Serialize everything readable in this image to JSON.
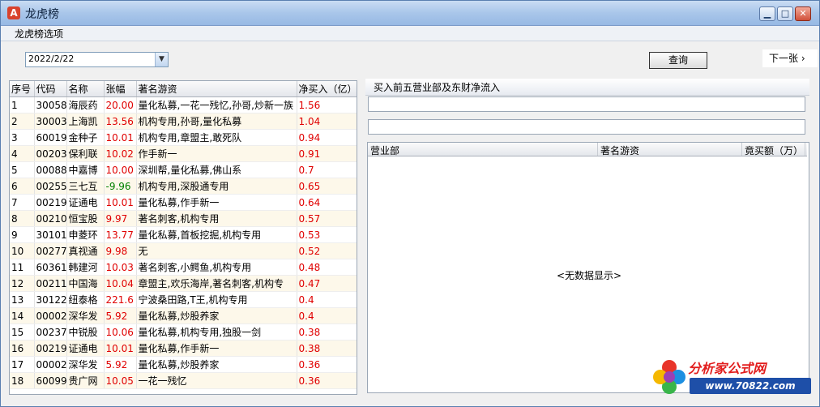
{
  "window": {
    "icon_label": "A",
    "title": "龙虎榜",
    "minimize_label": "▁",
    "maximize_label": "□",
    "close_label": "✕"
  },
  "menu": {
    "items": [
      "龙虎榜选项"
    ]
  },
  "toolbar": {
    "date_value": "2022/2/22",
    "dropdown_icon": "chevron-down-icon",
    "query_label": "查询",
    "next_page_label": "下一张 ›"
  },
  "left_table": {
    "columns": [
      "序号",
      "代码",
      "名称",
      "张幅",
      "著名游资",
      "净买入（亿）"
    ],
    "rows": [
      [
        "1",
        "30058",
        "海辰药",
        "20.00",
        "量化私募,一花一残忆,孙哥,炒新一族",
        "1.56"
      ],
      [
        "2",
        "30003",
        "上海凯",
        "13.56",
        "机构专用,孙哥,量化私募",
        "1.04"
      ],
      [
        "3",
        "60019",
        "金种子",
        "10.01",
        "机构专用,章盟主,敢死队",
        "0.94"
      ],
      [
        "4",
        "00203",
        "保利联",
        "10.02",
        "作手新一",
        "0.91"
      ],
      [
        "5",
        "00088",
        "中嘉博",
        "10.00",
        "深圳帮,量化私募,佛山系",
        "0.7"
      ],
      [
        "6",
        "00255",
        "三七互",
        "-9.96",
        "机构专用,深股通专用",
        "0.65"
      ],
      [
        "7",
        "00219",
        "证通电",
        "10.01",
        "量化私募,作手新一",
        "0.64"
      ],
      [
        "8",
        "00210",
        "恒宝股",
        "9.97",
        "著名刺客,机构专用",
        "0.57"
      ],
      [
        "9",
        "30101",
        "申菱环",
        "13.77",
        "量化私募,首板挖掘,机构专用",
        "0.53"
      ],
      [
        "10",
        "00277",
        "真视通",
        "9.98",
        "无",
        "0.52"
      ],
      [
        "11",
        "60361",
        "韩建河",
        "10.03",
        "著名刺客,小鳄鱼,机构专用",
        "0.48"
      ],
      [
        "12",
        "00211",
        "中国海",
        "10.04",
        "章盟主,欢乐海岸,著名刺客,机构专",
        "0.47"
      ],
      [
        "13",
        "30122",
        "纽泰格",
        "221.6",
        "宁波桑田路,T王,机构专用",
        "0.4"
      ],
      [
        "14",
        "00002",
        "深华发",
        "5.92",
        "量化私募,炒股养家",
        "0.4"
      ],
      [
        "15",
        "00237",
        "中锐股",
        "10.06",
        "量化私募,机构专用,独股一剑",
        "0.38"
      ],
      [
        "16",
        "00219",
        "证通电",
        "10.01",
        "量化私募,作手新一",
        "0.38"
      ],
      [
        "17",
        "00002",
        "深华发",
        "5.92",
        "量化私募,炒股养家",
        "0.36"
      ],
      [
        "18",
        "60099",
        "贵广网",
        "10.05",
        "一花一残忆",
        "0.36"
      ]
    ]
  },
  "right_panel": {
    "header": "买入前五营业部及东财净流入",
    "columns": [
      "营业部",
      "著名游资",
      "竟买额（万）"
    ],
    "empty_text": "<无数据显示>"
  },
  "branding": {
    "name": "分析家公式网",
    "url": "www.70822.com"
  },
  "colors": {
    "up": "#e00000",
    "down": "#008000"
  }
}
